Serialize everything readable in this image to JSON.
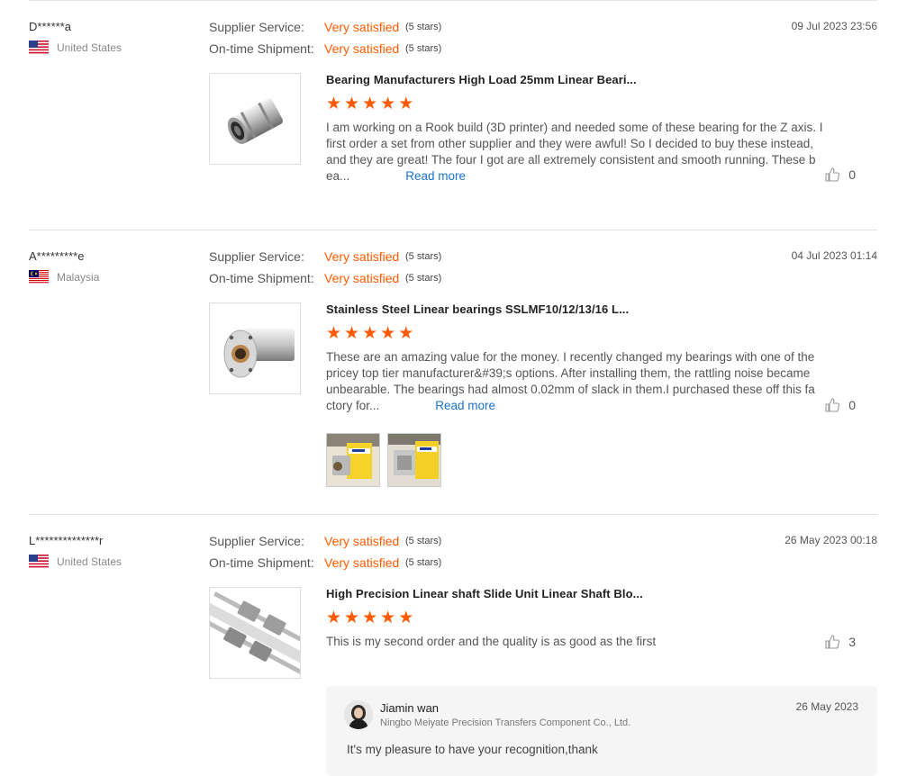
{
  "labels": {
    "supplier_service": "Supplier Service:",
    "ontime_shipment": "On-time Shipment:",
    "read_more": "Read more"
  },
  "reviews": [
    {
      "buyer": "D******a",
      "country": "United States",
      "flag": "us-flag",
      "supplier_rating": "Very satisfied",
      "supplier_stars": "(5 stars)",
      "shipment_rating": "Very satisfied",
      "shipment_stars": "(5 stars)",
      "date": "09 Jul 2023 23:56",
      "product_title": "Bearing Manufacturers High Load 25mm Linear Beari...",
      "rating": 5,
      "text": "I am working on a Rook build (3D printer) and needed some of these bearing for the Z axis. I first order a set from other supplier and they were awful! So I decided to buy these instead, and they are great! The four I got are all extremely consistent and smooth running. These b ea...",
      "likes": "0"
    },
    {
      "buyer": "A*********e",
      "country": "Malaysia",
      "flag": "malaysia-flag",
      "supplier_rating": "Very satisfied",
      "supplier_stars": "(5 stars)",
      "shipment_rating": "Very satisfied",
      "shipment_stars": "(5 stars)",
      "date": "04 Jul 2023 01:14",
      "product_title": "Stainless Steel Linear bearings SSLMF10/12/13/16 L...",
      "rating": 5,
      "text": "These are an amazing value for the money. I recently changed my bearings with one of the pricey top tier manufacturer&#39;s options. After installing them, the rattling noise became unbearable. The bearings had almost 0.02mm of slack in them.I purchased these off this fa ctory for...",
      "likes": "0",
      "photos": [
        "review-photo-1",
        "review-photo-2"
      ]
    },
    {
      "buyer": "L**************r",
      "country": "United States",
      "flag": "us-flag",
      "supplier_rating": "Very satisfied",
      "supplier_stars": "(5 stars)",
      "shipment_rating": "Very satisfied",
      "shipment_stars": "(5 stars)",
      "date": "26 May 2023 00:18",
      "product_title": "High Precision Linear shaft Slide Unit Linear Shaft Blo...",
      "rating": 5,
      "text": "This is my second order and the quality is as good as the first",
      "likes": "3",
      "reply": {
        "name": "Jiamin wan",
        "company": "Ningbo Meiyate Precision Transfers Component Co., Ltd.",
        "date": "26 May 2023",
        "text": "It's my pleasure to have your recognition,thank"
      }
    }
  ],
  "colors": {
    "accent": "#ff5a00",
    "link": "#1a73c8"
  }
}
